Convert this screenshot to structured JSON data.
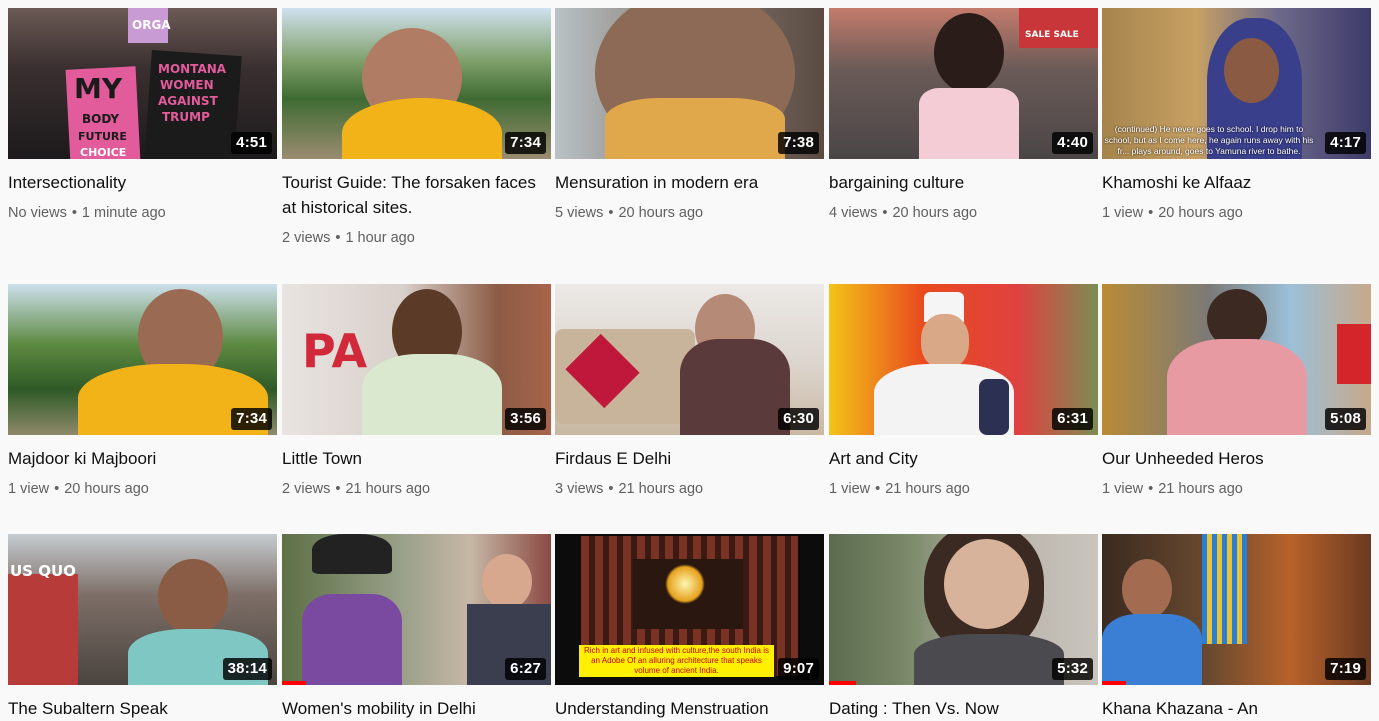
{
  "videos": [
    {
      "title": "Intersectionality",
      "views": "No views",
      "age": "1 minute ago",
      "duration": "4:51",
      "thumb_signs": [
        "MY",
        "BODY",
        "FUTURE",
        "CHOICE",
        "MONTANA",
        "WOMEN",
        "AGAINST",
        "TRUMP",
        "ORGA"
      ]
    },
    {
      "title": "Tourist Guide: The forsaken faces at historical sites.",
      "views": "2 views",
      "age": "1 hour ago",
      "duration": "7:34"
    },
    {
      "title": "Mensuration in modern era",
      "views": "5 views",
      "age": "20 hours ago",
      "duration": "7:38"
    },
    {
      "title": "bargaining culture",
      "views": "4 views",
      "age": "20 hours ago",
      "duration": "4:40",
      "thumb_signs": [
        "SALE SALE"
      ]
    },
    {
      "title": "Khamoshi ke Alfaaz",
      "views": "1 view",
      "age": "20 hours ago",
      "duration": "4:17",
      "thumb_caption": "(continued) He never goes to school. I drop him to school, but as I come here, he again runs away with his fr... plays around, goes to Yamuna river to bathe."
    },
    {
      "title": "Majdoor ki Majboori",
      "views": "1 view",
      "age": "20 hours ago",
      "duration": "7:34"
    },
    {
      "title": "Little Town",
      "views": "2 views",
      "age": "21 hours ago",
      "duration": "3:56",
      "thumb_signs": [
        "PA"
      ]
    },
    {
      "title": "Firdaus E Delhi",
      "views": "3 views",
      "age": "21 hours ago",
      "duration": "6:30"
    },
    {
      "title": "Art and City",
      "views": "1 view",
      "age": "21 hours ago",
      "duration": "6:31"
    },
    {
      "title": "Our Unheeded Heros",
      "views": "1 view",
      "age": "21 hours ago",
      "duration": "5:08"
    },
    {
      "title": "The Subaltern Speak",
      "duration": "38:14",
      "thumb_signs": [
        "US QUO"
      ]
    },
    {
      "title": "Women's mobility in Delhi",
      "duration": "6:27",
      "progress_pct": 9
    },
    {
      "title": "Understanding Menstruation",
      "duration": "9:07",
      "thumb_caption": "Rich in art and infused with culture,the south India is an Adobe Of an alluring architecture that speaks volume of ancient India."
    },
    {
      "title": "Dating : Then Vs. Now",
      "duration": "5:32",
      "progress_pct": 10
    },
    {
      "title": "Khana Khazana - An",
      "duration": "7:19",
      "progress_pct": 9
    }
  ],
  "colors": {
    "background": "#f9f9f9",
    "title": "#0f0f0f",
    "meta": "#606060",
    "progress": "#ff0000"
  },
  "meta_separator": "•"
}
